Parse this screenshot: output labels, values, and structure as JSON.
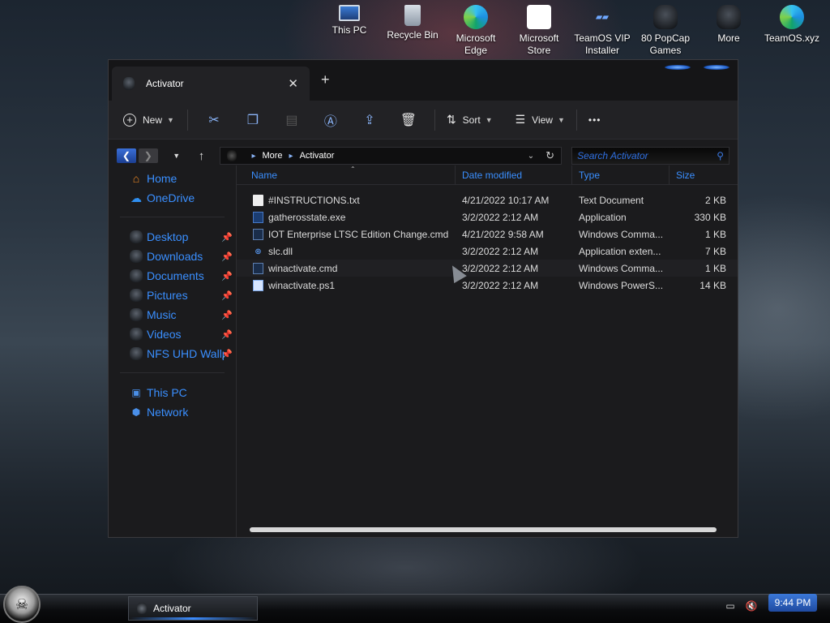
{
  "desktop": {
    "icons": [
      {
        "label_line1": "This PC",
        "label_line2": "",
        "icon": "computer-icon"
      },
      {
        "label_line1": "Recycle Bin",
        "label_line2": "",
        "icon": "recycle-bin-icon"
      },
      {
        "label_line1": "Microsoft",
        "label_line2": "Edge",
        "icon": "edge-icon"
      },
      {
        "label_line1": "Microsoft",
        "label_line2": "Store",
        "icon": "store-icon"
      },
      {
        "label_line1": "TeamOS VIP",
        "label_line2": "Installer",
        "icon": "teamos-installer-icon"
      },
      {
        "label_line1": "80 PopCap",
        "label_line2": "Games",
        "icon": "folder-icon"
      },
      {
        "label_line1": "More",
        "label_line2": "",
        "icon": "folder-icon"
      },
      {
        "label_line1": "TeamOS.xyz",
        "label_line2": "",
        "icon": "edge-icon"
      }
    ]
  },
  "window": {
    "tab_title": "Activator",
    "close_glyph": "✕",
    "new_tab_glyph": "+"
  },
  "toolbar": {
    "new_label": "New",
    "sort_label": "Sort",
    "view_label": "View",
    "more_glyph": "•••",
    "icons": [
      "cut-icon",
      "copy-icon",
      "paste-icon",
      "rename-icon",
      "share-icon",
      "delete-icon"
    ]
  },
  "address": {
    "crumbs": [
      "More",
      "Activator"
    ],
    "search_placeholder": "Search Activator"
  },
  "sidebar": {
    "items": [
      {
        "label": "Home",
        "icon": "home-icon",
        "pinned": false
      },
      {
        "label": "OneDrive",
        "icon": "cloud-icon",
        "pinned": false
      },
      {
        "label": "Desktop",
        "icon": "desktop-icon",
        "pinned": true
      },
      {
        "label": "Downloads",
        "icon": "downloads-icon",
        "pinned": true
      },
      {
        "label": "Documents",
        "icon": "documents-icon",
        "pinned": true
      },
      {
        "label": "Pictures",
        "icon": "pictures-icon",
        "pinned": true
      },
      {
        "label": "Music",
        "icon": "music-icon",
        "pinned": true
      },
      {
        "label": "Videos",
        "icon": "videos-icon",
        "pinned": true
      },
      {
        "label": "NFS UHD Wallp",
        "icon": "folder-icon",
        "pinned": true
      },
      {
        "label": "This PC",
        "icon": "computer-icon",
        "pinned": false
      },
      {
        "label": "Network",
        "icon": "network-icon",
        "pinned": false
      }
    ]
  },
  "files": {
    "columns": {
      "name": "Name",
      "date": "Date modified",
      "type": "Type",
      "size": "Size"
    },
    "rows": [
      {
        "name": "#INSTRUCTIONS.txt",
        "date": "4/21/2022 10:17 AM",
        "type": "Text Document",
        "size": "2 KB",
        "icon": "text-file-icon"
      },
      {
        "name": "gatherosstate.exe",
        "date": "3/2/2022 2:12 AM",
        "type": "Application",
        "size": "330 KB",
        "icon": "exe-file-icon"
      },
      {
        "name": "IOT Enterprise LTSC Edition Change.cmd",
        "date": "4/21/2022 9:58 AM",
        "type": "Windows Comma...",
        "size": "1 KB",
        "icon": "cmd-file-icon"
      },
      {
        "name": "slc.dll",
        "date": "3/2/2022 2:12 AM",
        "type": "Application exten...",
        "size": "7 KB",
        "icon": "dll-file-icon"
      },
      {
        "name": "winactivate.cmd",
        "date": "3/2/2022 2:12 AM",
        "type": "Windows Comma...",
        "size": "1 KB",
        "icon": "cmd-file-icon"
      },
      {
        "name": "winactivate.ps1",
        "date": "3/2/2022 2:12 AM",
        "type": "Windows PowerS...",
        "size": "14 KB",
        "icon": "ps1-file-icon"
      }
    ],
    "hovered_row_index": 4
  },
  "taskbar": {
    "task_label": "Activator",
    "clock": "9:44 PM"
  }
}
